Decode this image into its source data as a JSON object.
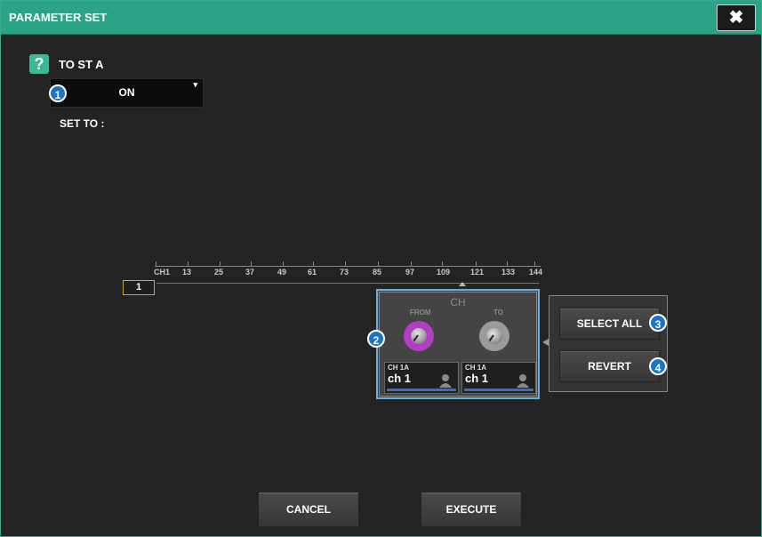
{
  "window": {
    "title": "PARAMETER SET",
    "close_glyph": "✖"
  },
  "help": {
    "glyph": "?"
  },
  "to_label": "TO ST A",
  "dropdown": {
    "value": "ON",
    "caret": "▾"
  },
  "set_to_label": "SET TO :",
  "channel_scale": {
    "labels": [
      "CH1",
      "13",
      "25",
      "37",
      "49",
      "61",
      "73",
      "85",
      "97",
      "109",
      "121",
      "133",
      "144"
    ],
    "current": "1"
  },
  "ch_panel": {
    "title": "CH",
    "from_label": "FROM",
    "to_label": "TO",
    "from_channel": {
      "id": "CH 1A",
      "name": "ch 1"
    },
    "to_channel": {
      "id": "CH 1A",
      "name": "ch 1"
    }
  },
  "buttons": {
    "select_all": "SELECT ALL",
    "revert": "REVERT",
    "cancel": "CANCEL",
    "execute": "EXECUTE"
  },
  "badges": [
    "1",
    "2",
    "3",
    "4"
  ],
  "colors": {
    "title_bar": "#2aa386",
    "from_knob": "#b23ec4",
    "badge": "#1b74c4",
    "selection": "#6aaee0"
  }
}
